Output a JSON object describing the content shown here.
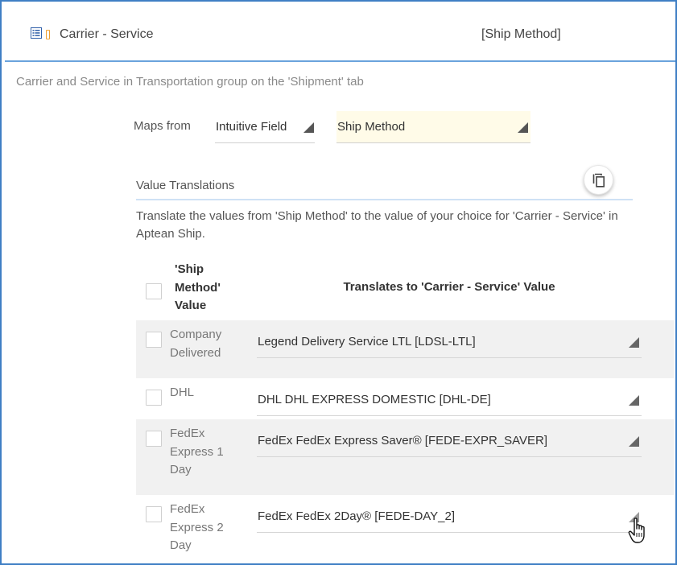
{
  "header": {
    "title": "Carrier - Service",
    "right_label": "[Ship Method]"
  },
  "subtitle": "Carrier and Service in Transportation group on the 'Shipment' tab",
  "maps_from": {
    "label": "Maps from",
    "source_type": "Intuitive Field",
    "source_field": "Ship Method"
  },
  "value_translations": {
    "title": "Value Translations",
    "description": "Translate the values from 'Ship Method' to the value of your choice for 'Carrier - Service' in Aptean Ship.",
    "copy_icon": "copy-icon"
  },
  "table": {
    "col_source": "'Ship Method' Value",
    "col_target": "Translates to 'Carrier - Service' Value",
    "rows": [
      {
        "source": "Company Delivered",
        "target": "Legend Delivery Service LTL [LDSL-LTL]"
      },
      {
        "source": "DHL",
        "target": "DHL DHL EXPRESS DOMESTIC [DHL-DE]"
      },
      {
        "source": "FedEx Express 1 Day",
        "target": "FedEx FedEx Express Saver® [FEDE-EXPR_SAVER]"
      },
      {
        "source": "FedEx Express 2 Day",
        "target": "FedEx FedEx 2Day® [FEDE-DAY_2]"
      }
    ]
  },
  "colors": {
    "frame_border": "#3f7fc4",
    "header_underline": "#6aa3dc",
    "highlight_field": "#fffbe8",
    "row_shade": "#f1f1f1"
  }
}
